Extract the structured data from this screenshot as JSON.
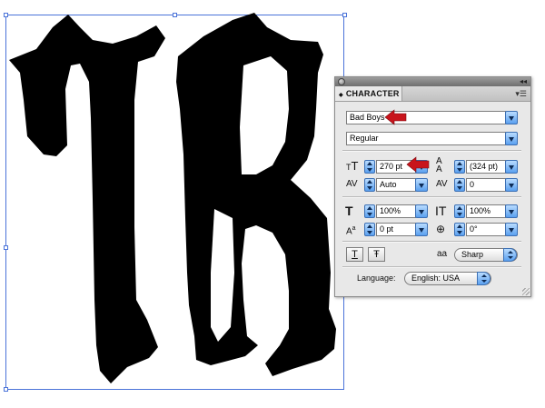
{
  "colors": {
    "selection": "#4a73d9",
    "annotation_arrow": "#c8141c",
    "glyph": "#000000",
    "panel_bg": "#e8e8e8"
  },
  "panel": {
    "tab_label": "CHARACTER",
    "font_family": "Bad Boys",
    "font_style": "Regular",
    "font_size": "270 pt",
    "leading": "(324 pt)",
    "kerning": "Auto",
    "tracking": "0",
    "vertical_scale": "100%",
    "horizontal_scale": "100%",
    "baseline_shift": "0 pt",
    "rotation": "0°",
    "underline_glyph": "T",
    "strikethrough_glyph": "Ŧ",
    "antialias_icon_text": "aa",
    "antialias_value": "Sharp",
    "language_label": "Language:",
    "language_value": "English: USA"
  },
  "icons": {
    "close": "close-icon",
    "collapse": "double-arrow-icon",
    "menu": "panel-menu-icon",
    "font_size": "font-size-icon",
    "leading": "leading-icon",
    "kerning": "kerning-icon",
    "tracking": "tracking-icon",
    "vertical_scale": "vertical-scale-icon",
    "horizontal_scale": "horizontal-scale-icon",
    "baseline_shift": "baseline-shift-icon",
    "rotation": "character-rotation-icon"
  }
}
